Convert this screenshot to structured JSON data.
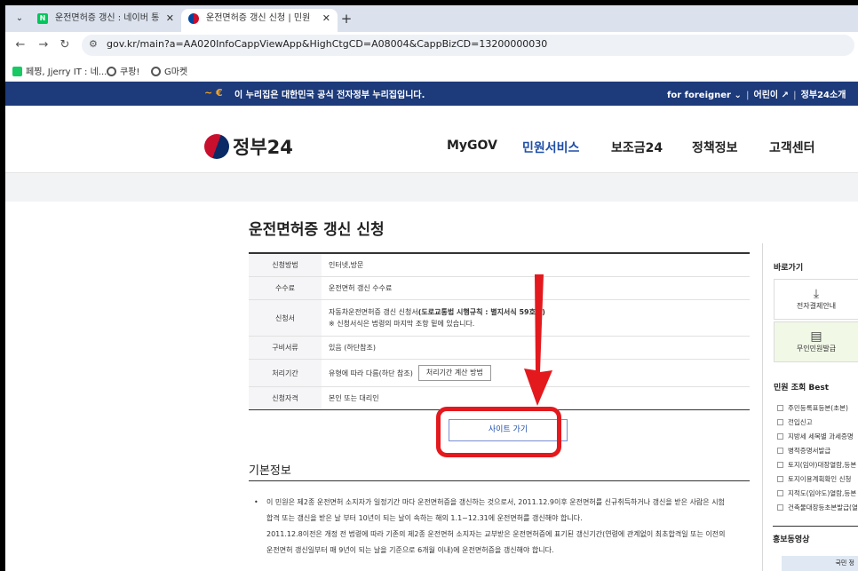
{
  "browser": {
    "tabs": [
      {
        "title": "운전면허증 갱신 : 네이버 통합",
        "active": false
      },
      {
        "title": "운전면허증 갱신 신청 | 민원안",
        "active": true
      }
    ],
    "url": "gov.kr/main?a=AA020InfoCappViewApp&HighCtgCD=A08004&CappBizCD=13200000030",
    "bookmarks": [
      "페찡, Jjerry IT : 네...",
      "쿠팡!",
      "G마켓"
    ]
  },
  "gov_banner": {
    "notice": "이 누리집은 대한민국 공식 전자정부 누리집입니다.",
    "foreigner": "for foreigner",
    "links": [
      "어린이",
      "정부24소개"
    ]
  },
  "header": {
    "logo": "정부24",
    "nav": [
      "MyGOV",
      "민원서비스",
      "보조금24",
      "정책정보",
      "고객센터"
    ]
  },
  "page": {
    "title": "운전면허증 갱신 신청",
    "rows": [
      {
        "label": "신청방법",
        "value": "인터넷,방문"
      },
      {
        "label": "수수료",
        "value": "운전면허 갱신 수수료"
      },
      {
        "label": "신청서",
        "value_prefix": "자동차운전면허증 갱신 신청서",
        "value_bold": "(도로교통법 시행규칙 : 별지서식 59호의)",
        "note": "※ 신청서식은 법령의 마지막 조항 밑에 있습니다."
      },
      {
        "label": "구비서류",
        "value": "있음 (하단참조)"
      },
      {
        "label": "처리기간",
        "value": "유형에 따라 다름(하단 참조)",
        "button": "처리기간 계산 방법"
      },
      {
        "label": "신청자격",
        "value": "본인 또는 대리인"
      }
    ],
    "site_button": "사이트 가기",
    "section_title": "기본정보",
    "basic_info": [
      "이 민원은 제2종 운전면허 소지자가 일정기간 마다 운전면허증을 갱신하는 것으로서, 2011.12.9이후 운전면허를 신규취득하거나 갱신을 받은 사람은 시험",
      "합격 또는 갱신을 받은 날 부터 10년이 되는 날이 속하는 해의 1.1~12.31에 운전면허를 갱신해야 합니다.",
      "2011.12.8이전은 개정 전 법령에 따라 기존의 제2종 운전면허 소지자는 교부받은 운전면허증에 표기된 갱신기간(연령에 관계없이 최초합격일 또는 이전의",
      "운전면허 갱신일부터 매 9년이 되는 날을 기준으로 6개월 이내)에 운전면허증을 갱신해야 합니다."
    ]
  },
  "sidebar": {
    "quick_title": "바로가기",
    "quick_links": [
      "전자결제안내",
      "무인민원발급"
    ],
    "best_title": "민원 조회 Best",
    "best_items": [
      "주민등록표등본(초본)",
      "전입신고",
      "지방세 세목별 과세증명",
      "병적증명서발급",
      "토지(임야)대장열람,등본",
      "토지이용계획확인 신청",
      "지적도(임야도)열람,등본",
      "건축물대장등초본발급(열람)"
    ],
    "promo_title": "홍보동영상",
    "promo_caption": "국민 정"
  }
}
